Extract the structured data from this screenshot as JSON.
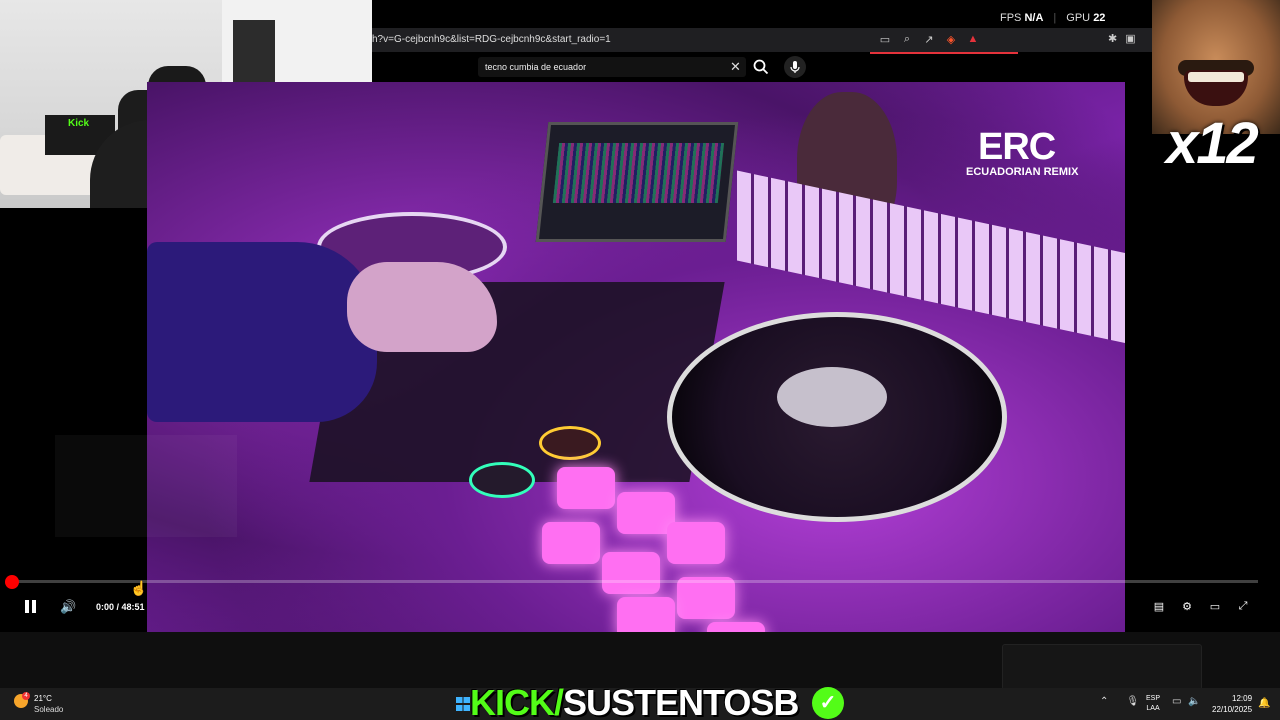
{
  "browser": {
    "url_fragment": "h?v=G-cejbcnh9c&list=RDG-cejbcnh9c&start_radio=1",
    "icons": [
      "cast-icon",
      "zoom-icon",
      "share-icon",
      "brave-shield-icon",
      "brave-rewards-icon"
    ],
    "right_icons": [
      "extensions-icon",
      "sidebar-icon"
    ]
  },
  "stats": {
    "fps_label": "FPS",
    "fps_value": "N/A",
    "gpu_label": "GPU",
    "gpu_value": "22"
  },
  "search": {
    "query": "tecno cumbia de ecuador",
    "clear_glyph": "✕"
  },
  "video": {
    "channel_logo": "ERC",
    "channel_subtitle": "ECUADORIAN REMIX"
  },
  "webcam": {
    "shirt_text": "Kick"
  },
  "meme": {
    "multiplier": "x12"
  },
  "player": {
    "time": "0:00 / 48:51",
    "progress": 0.0
  },
  "overlay": {
    "kick_prefix": "KICK/",
    "kick_name": "SUSTENTOSB",
    "check_glyph": "✓"
  },
  "taskbar": {
    "weather_temp": "21°C",
    "weather_desc": "Soleado",
    "weather_badge": "4",
    "lang_top": "ESP",
    "lang_bottom": "LAA",
    "time": "12:09",
    "date": "22/10/2025"
  },
  "colors": {
    "accent_red": "#ff0000",
    "kick_green": "#53fc18"
  }
}
